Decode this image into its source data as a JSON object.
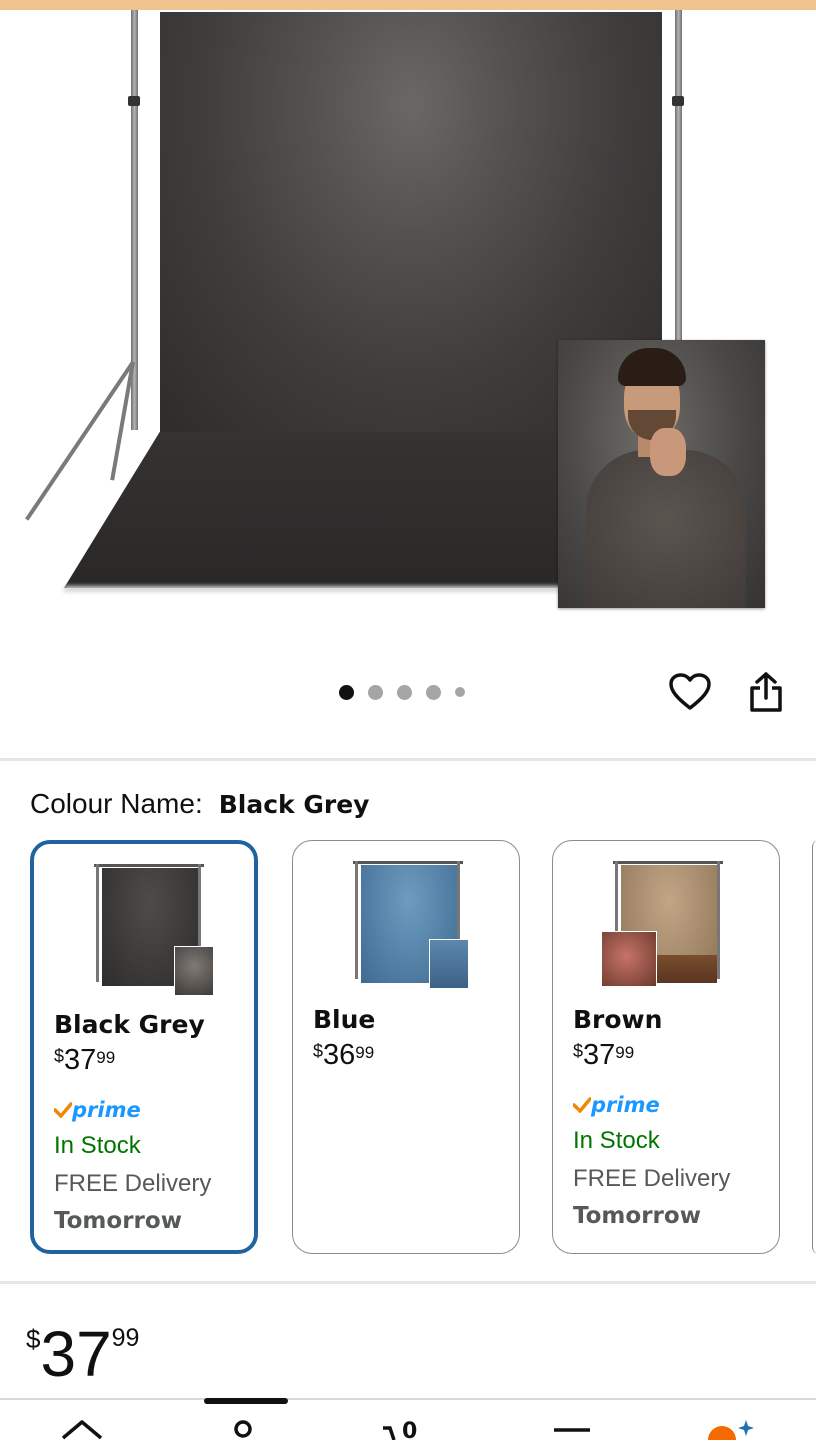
{
  "colour_section": {
    "label": "Colour Name:",
    "selected_value": "Black Grey"
  },
  "image_carousel": {
    "total_dots": 5,
    "active_index": 0
  },
  "actions": {
    "favorite_icon": "heart-icon",
    "share_icon": "share-icon"
  },
  "swatches": [
    {
      "name": "Black Grey",
      "price_symbol": "$",
      "price_whole": "37",
      "price_fraction": "99",
      "prime": "prime",
      "stock": "In Stock",
      "delivery": "FREE Delivery",
      "delivery_day": "Tomorrow",
      "selected": true,
      "cloth_color": "#3d3b3a"
    },
    {
      "name": "Blue",
      "price_symbol": "$",
      "price_whole": "36",
      "price_fraction": "99",
      "selected": false,
      "cloth_color": "#4d7aa0"
    },
    {
      "name": "Brown",
      "price_symbol": "$",
      "price_whole": "37",
      "price_fraction": "99",
      "prime": "prime",
      "stock": "In Stock",
      "delivery": "FREE Delivery",
      "delivery_day": "Tomorrow",
      "selected": false,
      "cloth_color": "#a8896a"
    }
  ],
  "price": {
    "symbol": "$",
    "whole": "37",
    "fraction": "99"
  },
  "bottom_nav": {
    "items": [
      "home-icon",
      "profile-icon",
      "cart-icon",
      "menu-icon",
      "rufus-icon"
    ]
  },
  "colors": {
    "selected_border": "#2162a1",
    "in_stock": "#007600",
    "prime_blue": "#1a98ff",
    "prime_check": "#f08804",
    "top_strip": "#f0c48f"
  }
}
